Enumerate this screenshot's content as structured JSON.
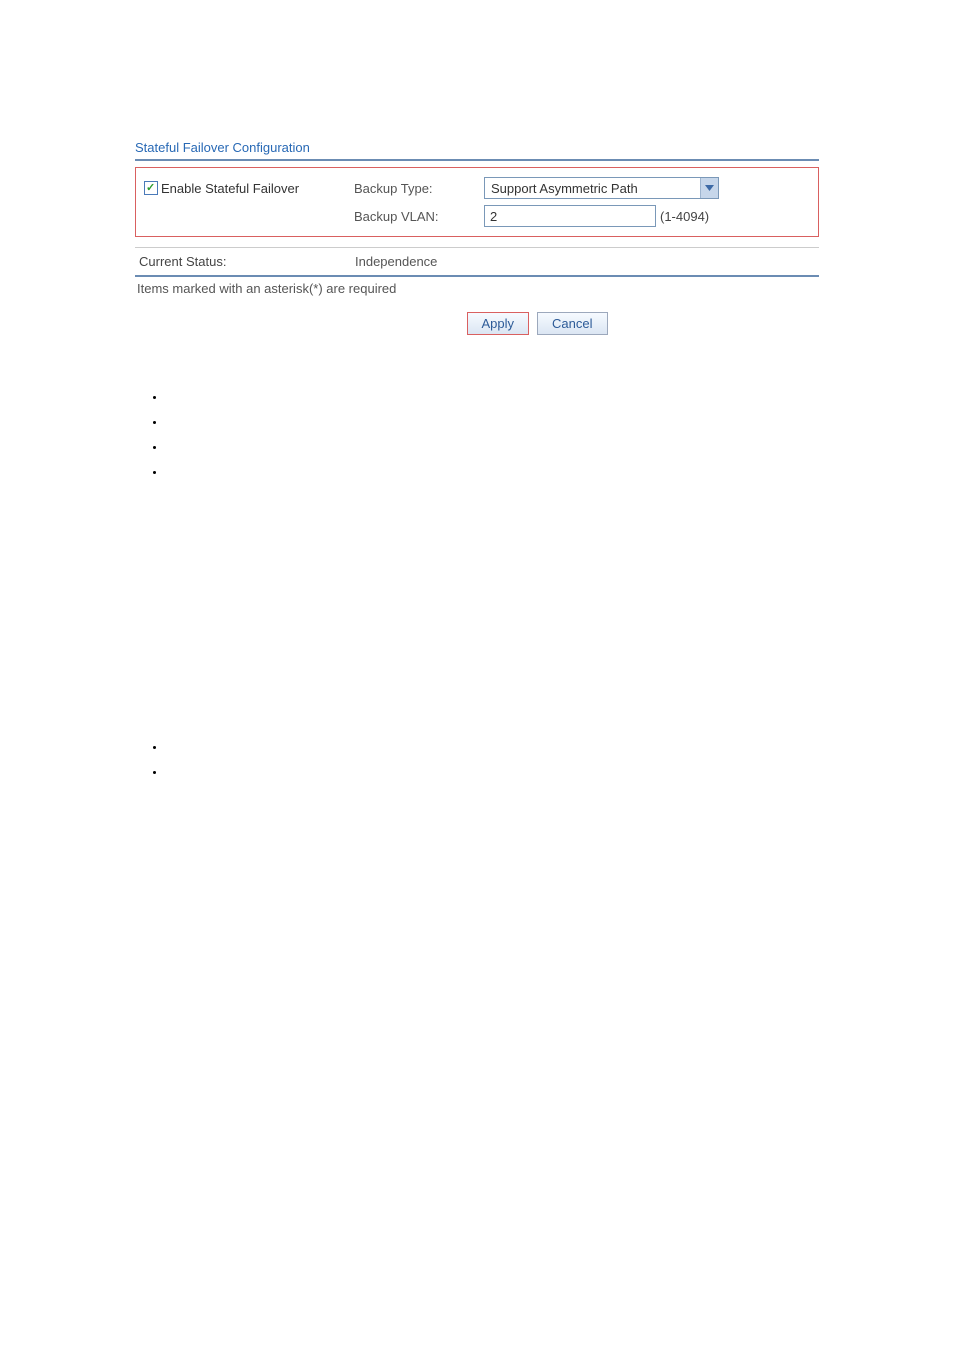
{
  "section_title": "Stateful Failover Configuration",
  "config": {
    "enable_label": "Enable Stateful Failover",
    "enable_checked": true,
    "backup_type_label": "Backup Type:",
    "backup_type_value": "Support Asymmetric Path",
    "backup_vlan_label": "Backup VLAN:",
    "backup_vlan_value": "2",
    "backup_vlan_range": "(1-4094)"
  },
  "status": {
    "label": "Current Status:",
    "value": "Independence"
  },
  "required_note": "Items marked with an asterisk(*) are required",
  "buttons": {
    "apply": "Apply",
    "cancel": "Cancel"
  }
}
